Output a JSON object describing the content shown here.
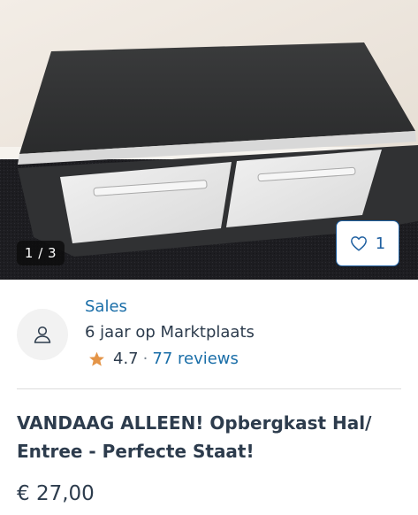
{
  "photo": {
    "counter": "1 / 3",
    "favorite_count": "1",
    "favorite_icon": "heart-outline-icon"
  },
  "seller": {
    "avatar_icon": "user-icon",
    "name": "Sales",
    "member_since": "6 jaar op Marktplaats",
    "star_icon": "star-icon",
    "rating": "4.7",
    "separator": "·",
    "reviews": "77 reviews"
  },
  "listing": {
    "title": "VANDAAG ALLEEN! Opbergkast Hal/ Entree - Perfecte Staat!",
    "price": "€ 27,00"
  },
  "colors": {
    "link_blue": "#1a6ea8",
    "accent_blue": "#1e5fa0",
    "text": "#2d3c4d",
    "star": "#e49447"
  }
}
